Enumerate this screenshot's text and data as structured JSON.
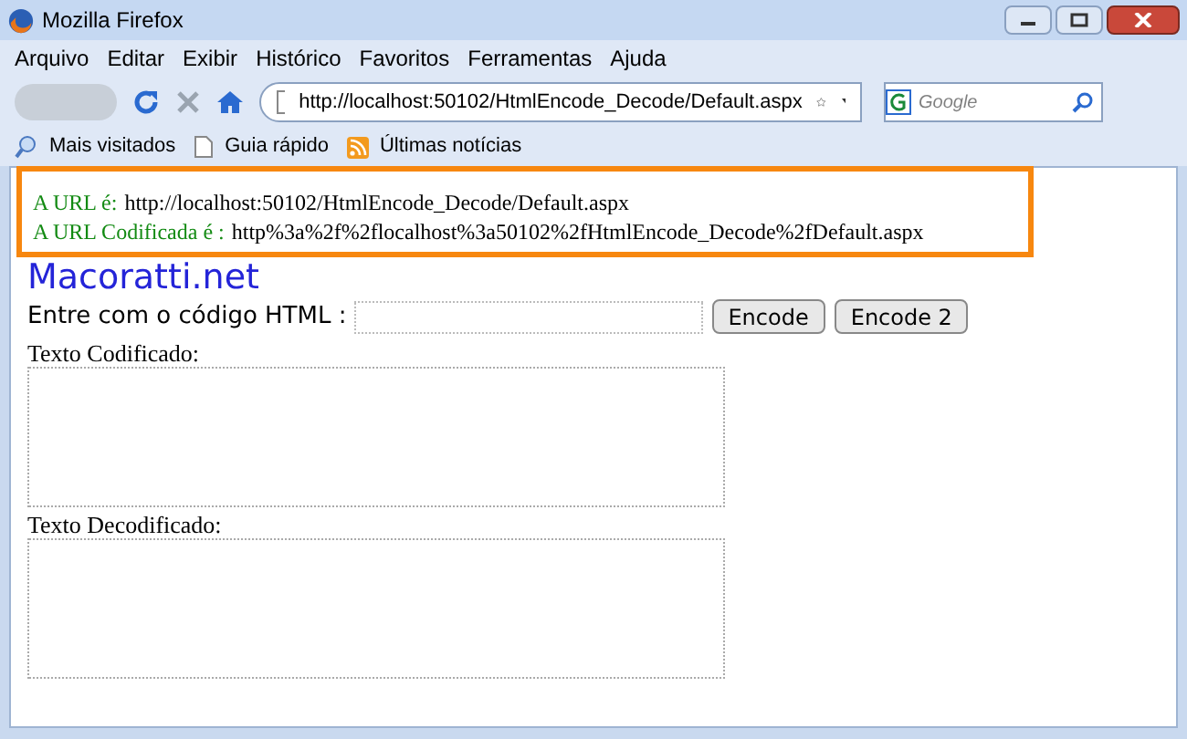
{
  "window": {
    "title": "Mozilla Firefox"
  },
  "menu": [
    "Arquivo",
    "Editar",
    "Exibir",
    "Histórico",
    "Favoritos",
    "Ferramentas",
    "Ajuda"
  ],
  "address_bar": {
    "value": "http://localhost:50102/HtmlEncode_Decode/Default.aspx"
  },
  "search": {
    "placeholder": "Google"
  },
  "bookmarks": [
    "Mais visitados",
    "Guia rápido",
    "Últimas notícias"
  ],
  "page": {
    "url_lines": [
      {
        "label": "A URL é:",
        "value": "http://localhost:50102/HtmlEncode_Decode/Default.aspx"
      },
      {
        "label": "A URL Codificada é :",
        "value": "http%3a%2f%2flocalhost%3a50102%2fHtmlEncode_Decode%2fDefault.aspx"
      }
    ],
    "site_title": "Macoratti.net",
    "input_label": "Entre com o código HTML :",
    "buttons": [
      "Encode",
      "Encode 2"
    ],
    "encoded_label": "Texto Codificado:",
    "decoded_label": "Texto Decodificado:"
  }
}
